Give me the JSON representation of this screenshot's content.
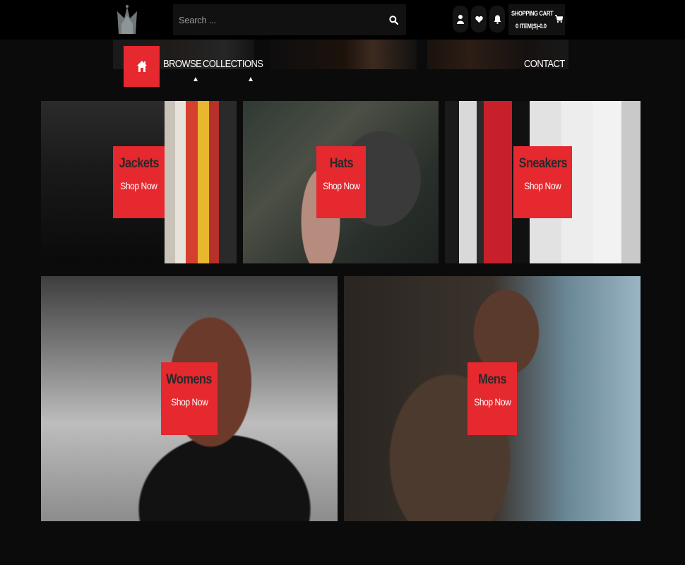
{
  "header": {
    "search": {
      "placeholder": "Search ..."
    },
    "cart": {
      "title": "SHOPPING CART",
      "count": "0 ITEM(S)-0.0"
    }
  },
  "icons": {
    "logo": "crown-logo-icon",
    "search": "search-icon",
    "user": "user-icon",
    "wishlist": "heart-icon",
    "notifications": "bell-icon",
    "cart": "cart-icon",
    "home": "home-icon"
  },
  "nav": {
    "browse": "BROWSE",
    "collections": "COLLECTIONS",
    "contact": "CONTACT"
  },
  "tiles": [
    {
      "title": "Jackets",
      "cta": "Shop Now"
    },
    {
      "title": "Hats",
      "cta": "Shop Now"
    },
    {
      "title": "Sneakers",
      "cta": "Shop Now"
    },
    {
      "title": "Womens",
      "cta": "Shop Now"
    },
    {
      "title": "Mens",
      "cta": "Shop Now"
    }
  ],
  "colors": {
    "accent": "#e6282f",
    "background": "#0b0b0b",
    "topbar": "#000000"
  }
}
